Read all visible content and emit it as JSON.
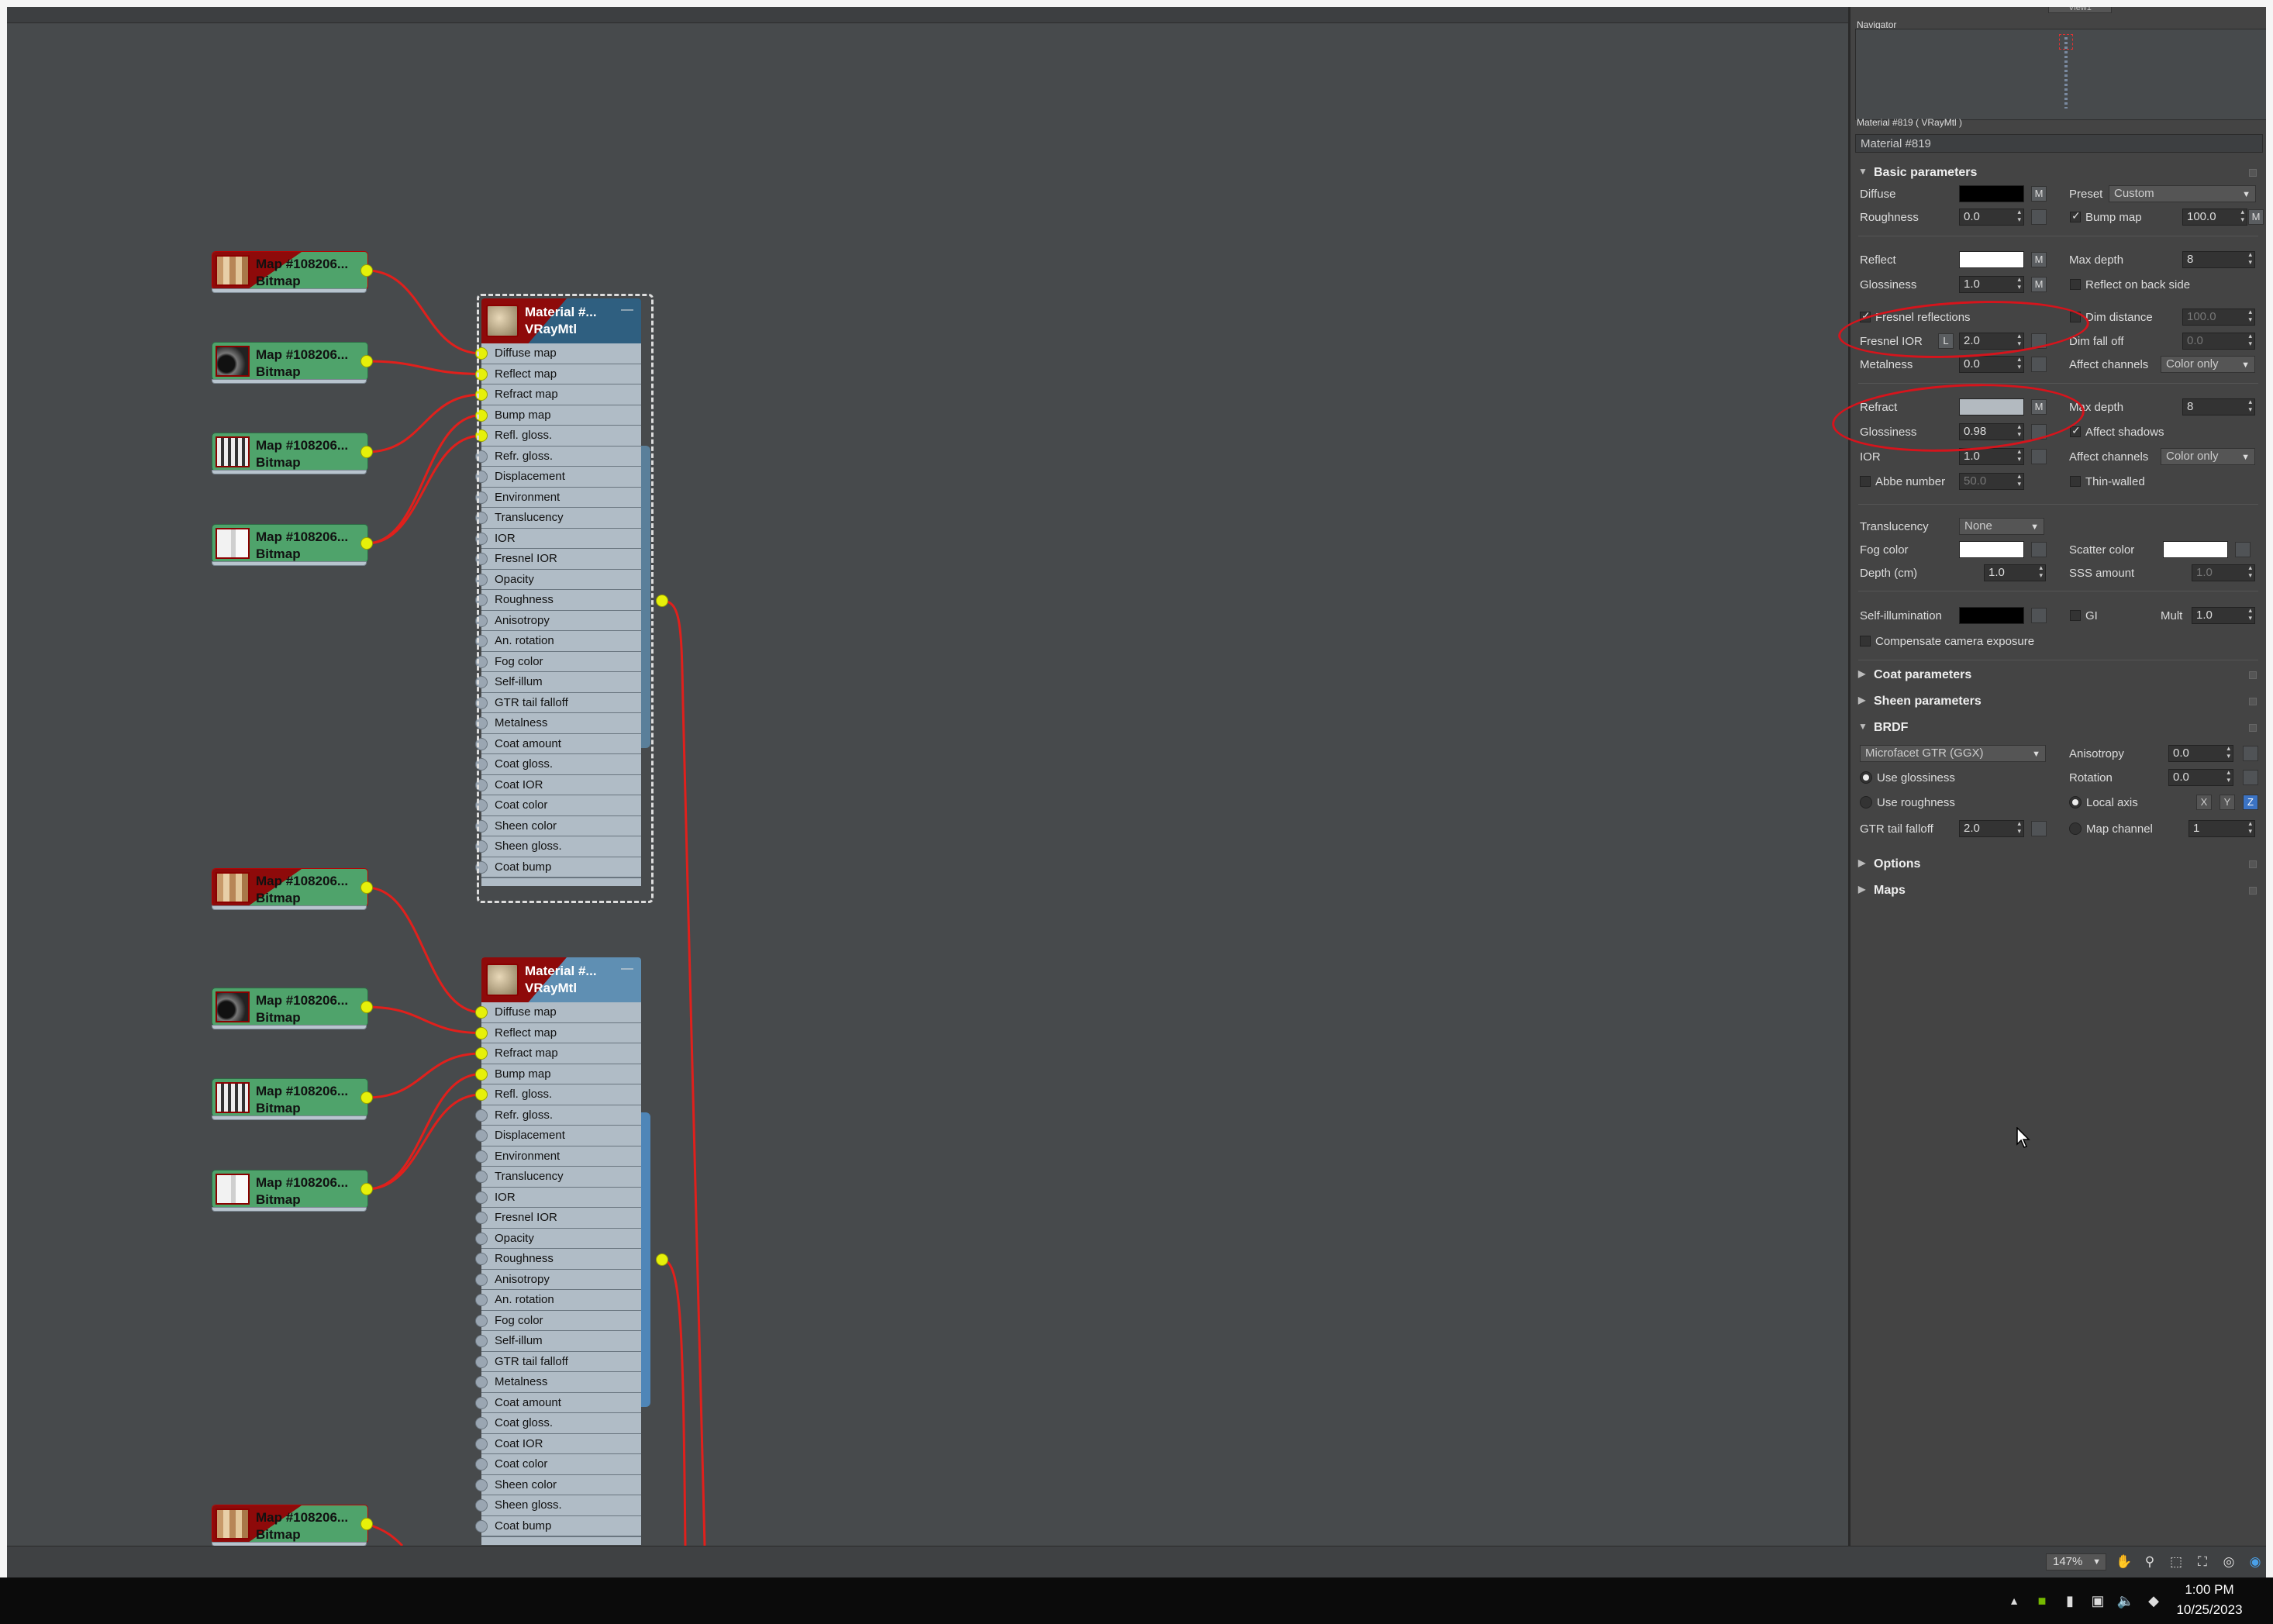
{
  "viewport_tab": "View1",
  "navigator": {
    "title": "Navigator"
  },
  "map_nodes": [
    {
      "title": "Map #108206...",
      "type": "Bitmap",
      "texture": "wood"
    },
    {
      "title": "Map #108206...",
      "type": "Bitmap",
      "texture": "dark"
    },
    {
      "title": "Map #108206...",
      "type": "Bitmap",
      "texture": "stripes"
    },
    {
      "title": "Map #108206...",
      "type": "Bitmap",
      "texture": "light"
    },
    {
      "title": "Map #108206...",
      "type": "Bitmap",
      "texture": "wood"
    },
    {
      "title": "Map #108206...",
      "type": "Bitmap",
      "texture": "dark"
    },
    {
      "title": "Map #108206...",
      "type": "Bitmap",
      "texture": "stripes"
    },
    {
      "title": "Map #108206...",
      "type": "Bitmap",
      "texture": "light"
    },
    {
      "title": "Map #108206...",
      "type": "Bitmap",
      "texture": "wood"
    }
  ],
  "material_nodes": [
    {
      "title": "Material #...",
      "type": "VRayMtl",
      "minimize": "—"
    },
    {
      "title": "Material #...",
      "type": "VRayMtl",
      "minimize": "—"
    }
  ],
  "material_slots": [
    "Diffuse map",
    "Reflect map",
    "Refract map",
    "Bump map",
    "Refl. gloss.",
    "Refr. gloss.",
    "Displacement",
    "Environment",
    "Translucency",
    "IOR",
    "Fresnel IOR",
    "Opacity",
    "Roughness",
    "Anisotropy",
    "An. rotation",
    "Fog color",
    "Self-illum",
    "GTR tail falloff",
    "Metalness",
    "Coat amount",
    "Coat gloss.",
    "Coat IOR",
    "Coat color",
    "Sheen color",
    "Sheen gloss.",
    "Coat bump"
  ],
  "panel": {
    "header": "Material #819  ( VRayMtl )",
    "name": "Material #819",
    "basic": {
      "title": "Basic parameters",
      "diffuse": "Diffuse",
      "m": "M",
      "preset": "Preset",
      "preset_value": "Custom",
      "roughness": "Roughness",
      "roughness_value": "0.0",
      "bump_map": "Bump map",
      "bump_value": "100.0",
      "reflect": "Reflect",
      "max_depth": "Max depth",
      "max_depth_value": "8",
      "glossiness": "Glossiness",
      "gloss_value": "1.0",
      "reflect_back": "Reflect on back side",
      "fresnel": "Fresnel reflections",
      "dim_distance": "Dim distance",
      "dim_distance_value": "100.0",
      "fresnel_ior": "Fresnel IOR",
      "l": "L",
      "fresnel_ior_value": "2.0",
      "dim_falloff": "Dim fall off",
      "dim_falloff_value": "0.0",
      "metalness": "Metalness",
      "metalness_value": "0.0",
      "affect_channels": "Affect channels",
      "color_only": "Color only",
      "refract": "Refract",
      "refract_max_depth_value": "8",
      "refract_gloss_value": "0.98",
      "affect_shadows": "Affect shadows",
      "ior": "IOR",
      "ior_value": "1.0",
      "abbe": "Abbe number",
      "abbe_value": "50.0",
      "thin_walled": "Thin-walled",
      "translucency": "Translucency",
      "translucency_value": "None",
      "fog_color": "Fog color",
      "scatter_color": "Scatter color",
      "depth": "Depth (cm)",
      "depth_value": "1.0",
      "sss_amount": "SSS amount",
      "sss_value": "1.0",
      "self_illum": "Self-illumination",
      "gi": "GI",
      "mult": "Mult",
      "mult_value": "1.0",
      "compensate": "Compensate camera exposure"
    },
    "coat": "Coat parameters",
    "sheen": "Sheen parameters",
    "brdf": {
      "title": "BRDF",
      "type": "Microfacet GTR (GGX)",
      "anisotropy": "Anisotropy",
      "anisotropy_value": "0.0",
      "use_glossiness": "Use glossiness",
      "rotation": "Rotation",
      "rotation_value": "0.0",
      "use_roughness": "Use roughness",
      "local_axis": "Local axis",
      "x": "X",
      "y": "Y",
      "z": "Z",
      "gtr": "GTR tail falloff",
      "gtr_value": "2.0",
      "map_channel": "Map channel",
      "map_channel_value": "1"
    },
    "options": "Options",
    "maps": "Maps"
  },
  "status": {
    "zoom": "147%"
  },
  "taskbar": {
    "time": "1:00 PM",
    "date": "10/25/2023"
  },
  "colors": {
    "wire": "#e0201c",
    "annotation": "#d6141c",
    "socket": "#e6f00a",
    "map_node": "#4fa36b"
  }
}
